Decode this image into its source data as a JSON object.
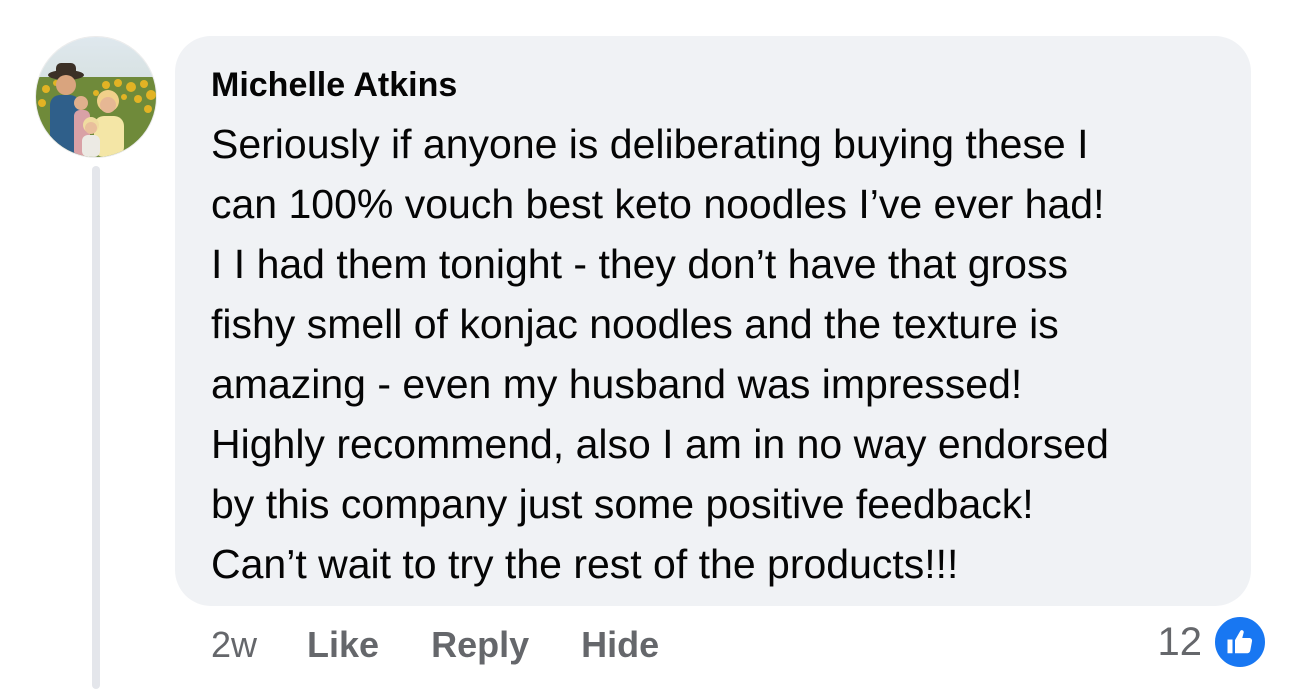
{
  "comment": {
    "author": "Michelle Atkins",
    "text": "Seriously if anyone is deliberating buying these I\ncan 100% vouch best keto noodles I’ve ever had!\nI I had them tonight - they don’t have that gross\nfishy smell of konjac noodles and the texture is\namazing - even my husband was impressed!\nHighly recommend, also I am in no way endorsed\nby this company just some positive feedback!\nCan’t wait to try the rest of the products!!!",
    "timestamp": "2w",
    "actions": {
      "like": "Like",
      "reply": "Reply",
      "hide": "Hide"
    },
    "reaction_count": "12",
    "reaction_icon": "thumbs-up-icon"
  },
  "colors": {
    "bubble_bg": "#f0f2f5",
    "secondary_text": "#65676b",
    "like_blue": "#1877f2",
    "thread_line": "#e4e6eb"
  }
}
